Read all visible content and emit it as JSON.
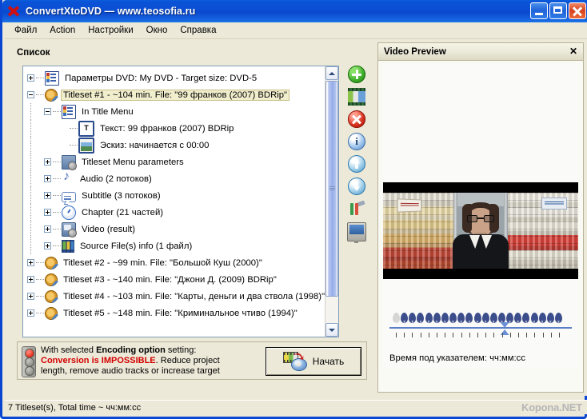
{
  "window": {
    "title": "ConvertXtoDVD — www.teosofia.ru",
    "app_icon": "red-x-icon",
    "buttons": {
      "minimize": "minimize-icon",
      "maximize": "maximize-icon",
      "close": "close-icon"
    }
  },
  "menubar": {
    "items": [
      {
        "label": "Файл"
      },
      {
        "label": "Action"
      },
      {
        "label": "Настройки"
      },
      {
        "label": "Окно"
      },
      {
        "label": "Справка"
      }
    ]
  },
  "left_panel": {
    "caption": "Список",
    "tree": [
      {
        "indent": 0,
        "twist": "plus",
        "icon": "dvd-params-icon",
        "label": "Параметры DVD: My DVD - Target size: DVD-5",
        "selected": false
      },
      {
        "indent": 0,
        "twist": "minus",
        "icon": "disc-icon",
        "label": "Titleset #1 - ~104 min. File: \"99 франков (2007) BDRip\"",
        "selected": true
      },
      {
        "indent": 1,
        "twist": "minus",
        "icon": "menu-list-icon",
        "label": "In Title Menu",
        "selected": false
      },
      {
        "indent": 2,
        "twist": "none",
        "icon": "text-icon",
        "label": "Текст: 99 франков (2007) BDRip",
        "selected": false
      },
      {
        "indent": 2,
        "twist": "none",
        "icon": "thumbnail-icon",
        "label": "Эскиз: начинается с 00:00",
        "selected": false
      },
      {
        "indent": 1,
        "twist": "plus",
        "icon": "menu-params-icon",
        "label": "Titleset Menu parameters",
        "selected": false
      },
      {
        "indent": 1,
        "twist": "plus",
        "icon": "audio-note-icon",
        "label": "Audio (2 потоков)",
        "selected": false
      },
      {
        "indent": 1,
        "twist": "plus",
        "icon": "subtitle-icon",
        "label": "Subtitle (3 потоков)",
        "selected": false
      },
      {
        "indent": 1,
        "twist": "plus",
        "icon": "chapter-clock-icon",
        "label": "Chapter (21 частей)",
        "selected": false
      },
      {
        "indent": 1,
        "twist": "plus",
        "icon": "video-result-icon",
        "label": "Video (result)",
        "selected": false
      },
      {
        "indent": 1,
        "twist": "plus",
        "icon": "source-files-icon",
        "label": "Source File(s) info (1 файл)",
        "selected": false
      },
      {
        "indent": 0,
        "twist": "plus",
        "icon": "disc-icon",
        "label": "Titleset #2 - ~99 min. File: \"Большой Куш (2000)\"",
        "selected": false
      },
      {
        "indent": 0,
        "twist": "plus",
        "icon": "disc-icon",
        "label": "Titleset #3 - ~140 min. File: \"Джони Д. (2009) BDRip\"",
        "selected": false
      },
      {
        "indent": 0,
        "twist": "plus",
        "icon": "disc-icon",
        "label": "Titleset #4 - ~103 min. File: \"Карты, деньги и два ствола (1998)\"",
        "selected": false
      },
      {
        "indent": 0,
        "twist": "plus",
        "icon": "disc-icon",
        "label": "Titleset #5 - ~148 min. File: \"Криминальное чтиво (1994)\"",
        "selected": false
      }
    ],
    "toolbar": [
      {
        "name": "add-titleset-button",
        "icon": "green-plus-icon"
      },
      {
        "name": "add-video-file-button",
        "icon": "film-strip-icon"
      },
      {
        "name": "delete-button",
        "icon": "red-delete-icon"
      },
      {
        "name": "info-button",
        "icon": "info-icon",
        "glyph": "i"
      },
      {
        "name": "move-up-button",
        "icon": "arrow-up-icon"
      },
      {
        "name": "move-down-button",
        "icon": "arrow-down-icon"
      },
      {
        "name": "tools-button",
        "icon": "tools-icon"
      },
      {
        "name": "preview-screen-button",
        "icon": "monitor-icon"
      }
    ],
    "warning": {
      "icon": "traffic-light-icon",
      "line1_pre": "With selected ",
      "line1_bold": "Encoding option",
      "line1_post": " setting:",
      "line2_red": "Conversion is IMPOSSIBLE",
      "line2_rest": ". Reduce project",
      "line3": "length, remove audio tracks or increase target"
    },
    "start_button": {
      "label": "Начать",
      "icon": "convert-to-disc-icon"
    }
  },
  "preview_panel": {
    "title": "Video Preview",
    "close_label": "✕",
    "time_label": "Время под указателем: чч:мм:cc",
    "timeline": {
      "pin_count": 21,
      "first_pin_inactive": true,
      "tick_count": 21,
      "cursor_position_percent": 63
    }
  },
  "statusbar": {
    "text": "7 Titleset(s), Total time ~ чч:мм:cc",
    "watermark": "Kopona.NET",
    "watermark_dots": "..."
  }
}
